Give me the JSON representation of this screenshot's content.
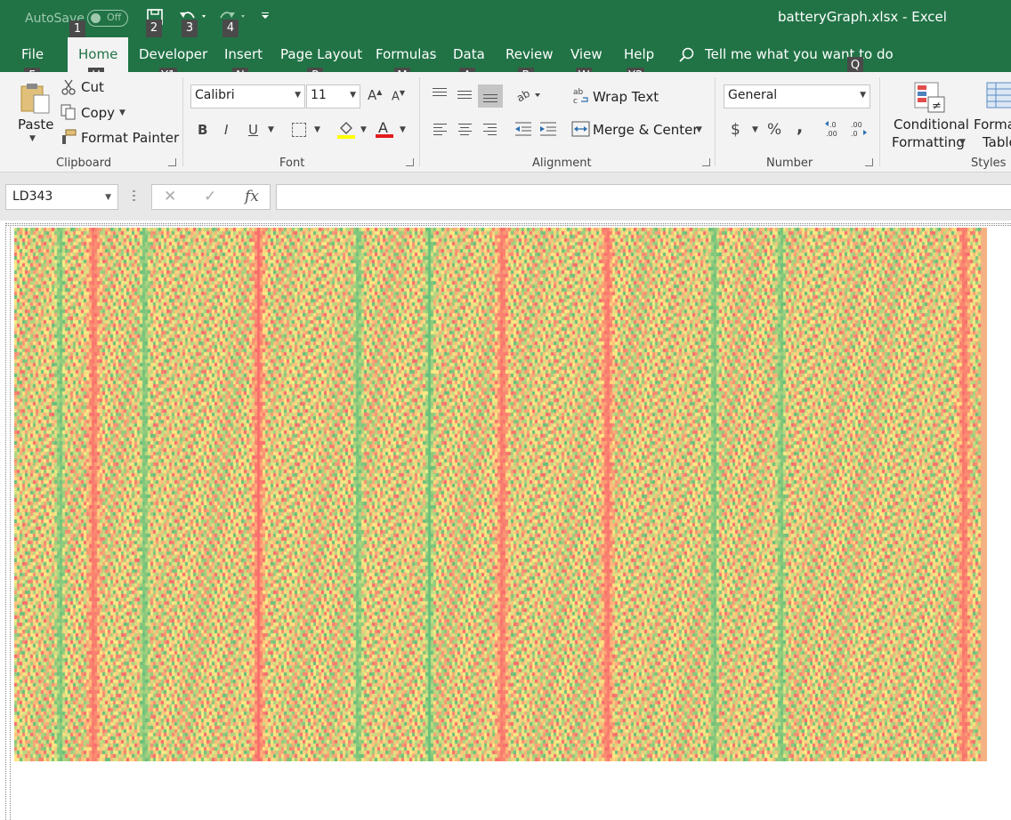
{
  "titlebar": {
    "autosave_label": "AutoSave",
    "autosave_state": "Off",
    "title": "batteryGraph.xlsx  -  Excel",
    "keytips": [
      "1",
      "2",
      "3",
      "4"
    ]
  },
  "tabs": [
    {
      "label": "File",
      "keytip": "F"
    },
    {
      "label": "Home",
      "keytip": "H"
    },
    {
      "label": "Developer",
      "keytip": "Y1"
    },
    {
      "label": "Insert",
      "keytip": "N"
    },
    {
      "label": "Page Layout",
      "keytip": "P"
    },
    {
      "label": "Formulas",
      "keytip": "M"
    },
    {
      "label": "Data",
      "keytip": "A"
    },
    {
      "label": "Review",
      "keytip": "R"
    },
    {
      "label": "View",
      "keytip": "W"
    },
    {
      "label": "Help",
      "keytip": "Y2"
    }
  ],
  "tellme": {
    "text": "Tell me what you want to do",
    "keytip": "Q"
  },
  "clipboard": {
    "paste": "Paste",
    "cut": "Cut",
    "copy": "Copy",
    "format_painter": "Format Painter",
    "group": "Clipboard"
  },
  "font": {
    "name": "Calibri",
    "size": "11",
    "bold": "B",
    "italic": "I",
    "underline": "U",
    "group": "Font"
  },
  "alignment": {
    "wrap_text": "Wrap Text",
    "merge_center": "Merge & Center",
    "group": "Alignment"
  },
  "number": {
    "format": "General",
    "currency": "$",
    "percent": "%",
    "comma": ",",
    "group": "Number"
  },
  "styles": {
    "conditional_line1": "Conditional",
    "conditional_line2": "Formatting",
    "format_table_line1": "Format as",
    "format_table_line2": "Table",
    "group": "Styles"
  },
  "formula_bar": {
    "name_box": "LD343",
    "fx": "fx"
  },
  "colors": {
    "excel_green": "#217346",
    "heat_red": "#f8696b",
    "heat_yellow": "#ffeb84",
    "heat_green": "#63be7b",
    "heat_orange": "#f4b183"
  }
}
